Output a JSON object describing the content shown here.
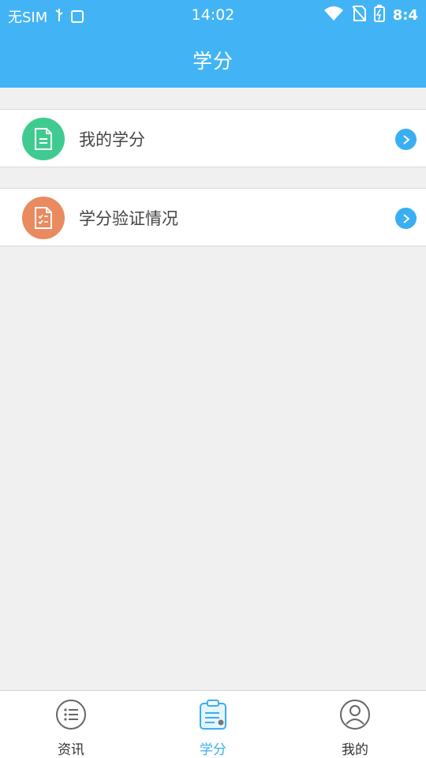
{
  "status_bar": {
    "carrier": "无SIM",
    "time": "14:02",
    "battery": "8:4"
  },
  "header": {
    "title": "学分"
  },
  "menu": [
    {
      "label": "我的学分",
      "icon": "document-icon",
      "color": "#3fcb8f"
    },
    {
      "label": "学分验证情况",
      "icon": "checklist-icon",
      "color": "#e98a5f"
    }
  ],
  "tabs": [
    {
      "label": "资讯",
      "icon": "list-icon",
      "active": false
    },
    {
      "label": "学分",
      "icon": "clipboard-icon",
      "active": true
    },
    {
      "label": "我的",
      "icon": "user-icon",
      "active": false
    }
  ],
  "colors": {
    "accent": "#42b4f5",
    "background": "#f0f0f0"
  }
}
